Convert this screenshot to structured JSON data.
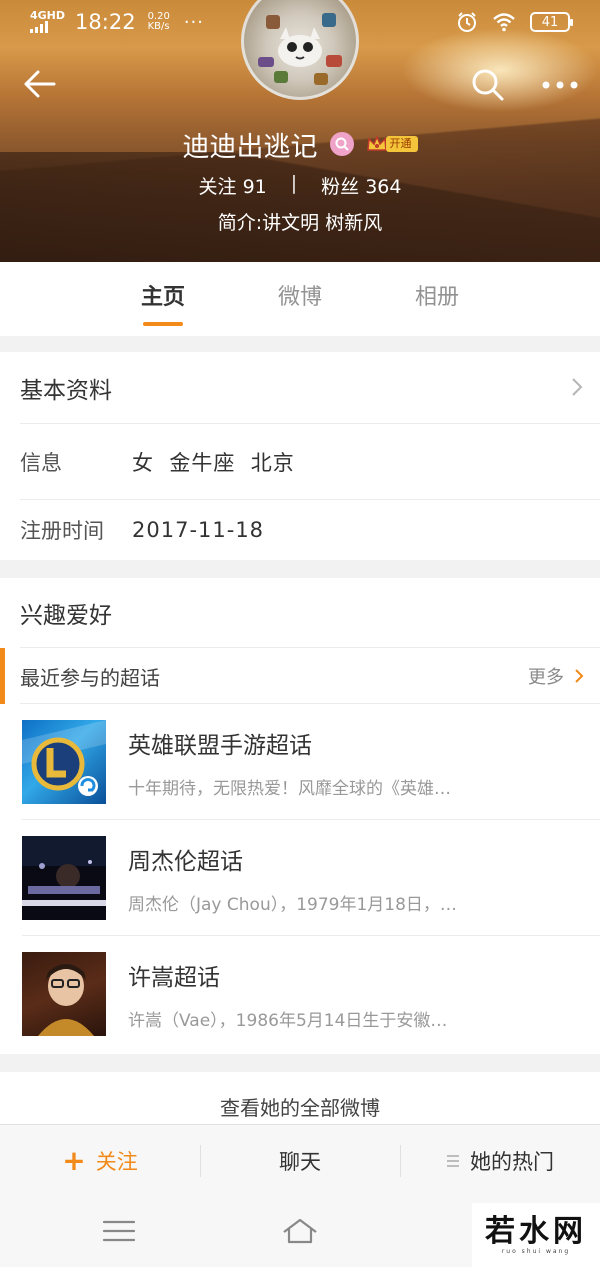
{
  "status_bar": {
    "network": "4GHD",
    "time": "18:22",
    "speed_value": "0.20",
    "speed_unit": "KB/s",
    "more": "···",
    "battery": "41"
  },
  "profile": {
    "name": "迪迪出逃记",
    "vip_label": "开通",
    "following_label": "关注",
    "following_count": "91",
    "stats_separator": "|",
    "followers_label": "粉丝",
    "followers_count": "364",
    "bio": "简介:讲文明 树新风"
  },
  "tabs": [
    {
      "label": "主页",
      "active": true
    },
    {
      "label": "微博",
      "active": false
    },
    {
      "label": "相册",
      "active": false
    }
  ],
  "basic_info": {
    "title": "基本资料",
    "info_label": "信息",
    "info_value": "女  金牛座  北京",
    "register_label": "注册时间",
    "register_value": "2017-11-18"
  },
  "interests": {
    "title": "兴趣爱好",
    "section_title": "最近参与的超话",
    "more_label": "更多",
    "topics": [
      {
        "name": "英雄联盟手游超话",
        "desc": "十年期待，无限热爱！风靡全球的《英雄…"
      },
      {
        "name": "周杰伦超话",
        "desc": "周杰伦（Jay Chou），1979年1月18日，…"
      },
      {
        "name": "许嵩超话",
        "desc": "许嵩（Vae），1986年5月14日生于安徽…"
      }
    ]
  },
  "view_all": "查看她的全部微博",
  "actions": {
    "follow_plus": "+",
    "follow": "关注",
    "chat": "聊天",
    "hot": "她的热门"
  },
  "watermark": {
    "title": "若水网",
    "subtitle": "ruo shui wang"
  },
  "colors": {
    "accent": "#f28a1a",
    "text_primary": "#333333",
    "text_secondary": "#999999"
  }
}
